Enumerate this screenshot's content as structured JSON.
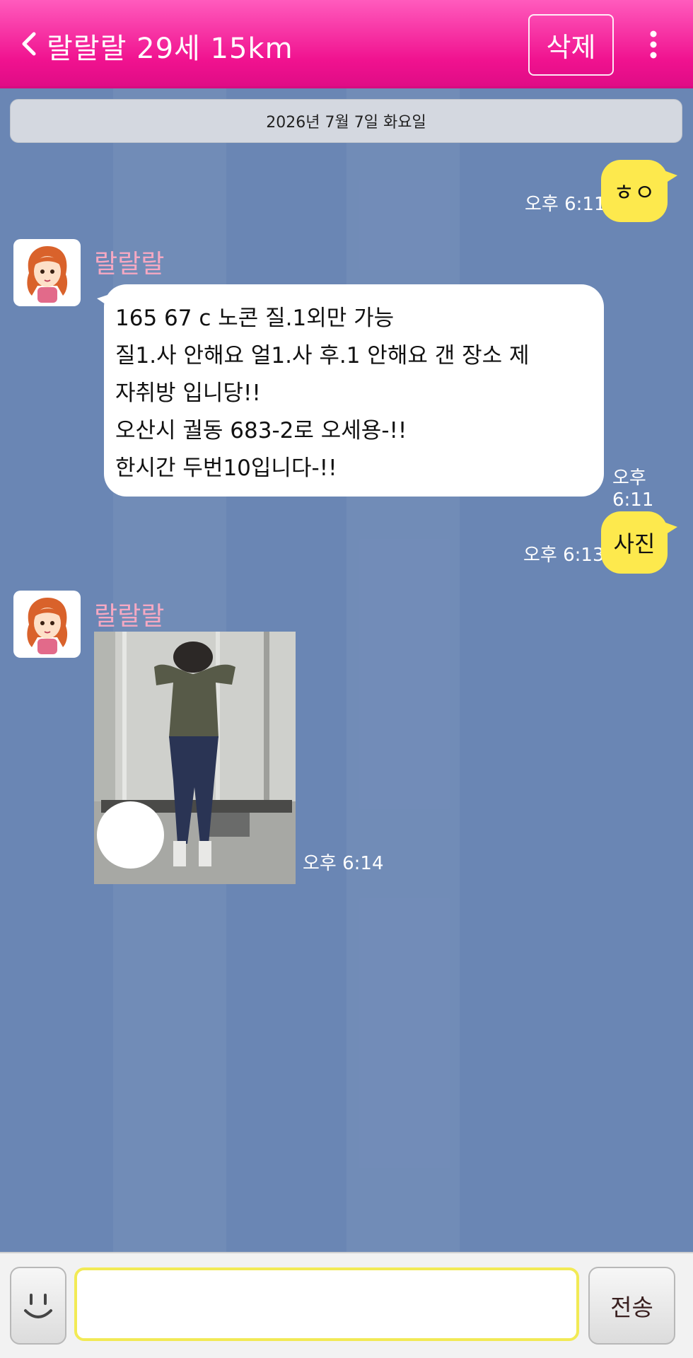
{
  "header": {
    "title": "랄랄랄 29세 15km",
    "delete_label": "삭제"
  },
  "date_bar": "2026년 7월 7일 화요일",
  "messages": [
    {
      "from": "me",
      "text": "ㅎㅇ",
      "time": "오후 6:11"
    },
    {
      "from": "them",
      "sender": "랄랄랄",
      "lines": [
        "165 67 c 노콘 질.1외만 가능",
        "질1.사 안해요 얼1.사 후.1 안해요 갠 장소 제",
        "자취방 입니당!!",
        "오산시 궐동 683-2로 오세용-!!",
        "한시간 두번10입니다-!!"
      ],
      "time": "오후 6:11"
    },
    {
      "from": "me",
      "text": "사진",
      "time": "오후 6:13"
    },
    {
      "from": "them",
      "sender": "랄랄랄",
      "type": "photo",
      "time": "오후 6:14"
    }
  ],
  "input": {
    "value": "",
    "placeholder": ""
  },
  "send_label": "전송",
  "colors": {
    "header": "#f0128f",
    "chat_background": "#6a86b4",
    "my_bubble": "#fde94d",
    "their_bubble": "#ffffff",
    "sender_name": "#f5a8c2",
    "input_border": "#f2ea55"
  }
}
